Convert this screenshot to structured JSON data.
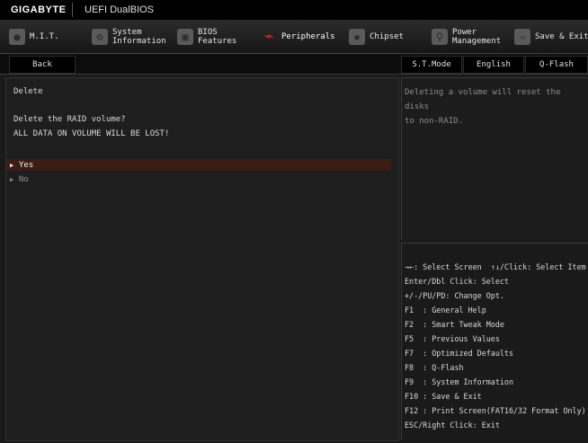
{
  "topbar": {
    "brand": "GIGABYTE",
    "product": "UEFI DualBIOS"
  },
  "tabs": [
    {
      "label": "M.I.T.",
      "icon": "mit-icon"
    },
    {
      "label": "System\nInformation",
      "icon": "gear-icon"
    },
    {
      "label": "BIOS\nFeatures",
      "icon": "bios-icon"
    },
    {
      "label": "Peripherals",
      "icon": "peripherals-icon"
    },
    {
      "label": "Chipset",
      "icon": "chipset-icon"
    },
    {
      "label": "Power\nManagement",
      "icon": "power-icon"
    },
    {
      "label": "Save & Exit",
      "icon": "exit-icon"
    }
  ],
  "subbar": {
    "back": "Back",
    "st_mode": "S.T.Mode",
    "language": "English",
    "qflash": "Q-Flash"
  },
  "main": {
    "title": "Delete",
    "question": "Delete the RAID volume?",
    "warning": "ALL DATA ON VOLUME WILL BE LOST!",
    "options": [
      "Yes",
      "No"
    ]
  },
  "help": {
    "line1": "Deleting a volume will reset the disks",
    "line2": "to non-RAID."
  },
  "keys": [
    "→←: Select Screen  ↑↓/Click: Select Item",
    "Enter/Dbl Click: Select",
    "+/-/PU/PD: Change Opt.",
    "F1  : General Help",
    "F2  : Smart Tweak Mode",
    "F5  : Previous Values",
    "F7  : Optimized Defaults",
    "F8  : Q-Flash",
    "F9  : System Information",
    "F10 : Save & Exit",
    "F12 : Print Screen(FAT16/32 Format Only)",
    "ESC/Right Click: Exit"
  ],
  "colors": {
    "accent": "#e8202a",
    "selection": "#3a1e16"
  }
}
